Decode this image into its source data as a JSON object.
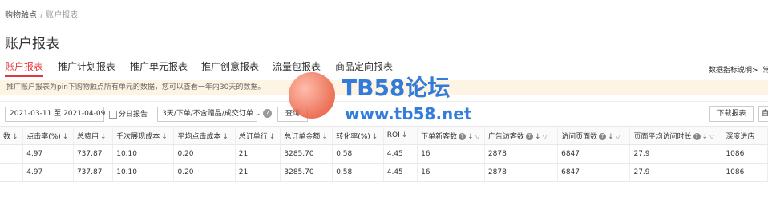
{
  "breadcrumb": {
    "root": "购物触点",
    "separator": "/",
    "current": "账户报表"
  },
  "page_title": "账户报表",
  "tabs": [
    {
      "label": "账户报表",
      "active": true
    },
    {
      "label": "推广计划报表",
      "active": false
    },
    {
      "label": "推广单元报表",
      "active": false
    },
    {
      "label": "推广创意报表",
      "active": false
    },
    {
      "label": "流量包报表",
      "active": false
    },
    {
      "label": "商品定向报表",
      "active": false
    }
  ],
  "help_link": {
    "label": "数据指标说明>",
    "cut_label": "常"
  },
  "notice": "推广账户报表为pin下购物触点所有单元的数据，您可以查看一年内30天的数据。",
  "toolbar": {
    "date_range": "2021-03-11 至 2021-04-09",
    "daily_report_label": "分日报告",
    "attribution_select": "3天/下单/不含赠品/成交订单",
    "help_icon": "?",
    "query_label": "查询",
    "download_label": "下载报表",
    "cut_button_label": "自"
  },
  "table": {
    "columns": [
      {
        "label": "数",
        "sort": true
      },
      {
        "label": "点击率(%)",
        "sort": true
      },
      {
        "label": "总费用",
        "sort": true
      },
      {
        "label": "千次展现成本",
        "sort": true
      },
      {
        "label": "平均点击成本",
        "sort": true
      },
      {
        "label": "总订单行",
        "sort": true
      },
      {
        "label": "总订单金额",
        "sort": true
      },
      {
        "label": "转化率(%)",
        "sort": true
      },
      {
        "label": "ROI",
        "sort": true
      },
      {
        "label": "下单新客数",
        "sort": true,
        "help": true,
        "filter": true
      },
      {
        "label": "广告访客数",
        "sort": true,
        "help": true,
        "filter": true
      },
      {
        "label": "访问页面数",
        "sort": true,
        "help": true,
        "filter": true
      },
      {
        "label": "页面平均访问时长",
        "sort": true,
        "help": true,
        "filter": true
      },
      {
        "label": "深度进店",
        "sort": false
      }
    ],
    "rows": [
      [
        "",
        "4.97",
        "737.87",
        "10.10",
        "0.20",
        "21",
        "3285.70",
        "0.58",
        "4.45",
        "16",
        "2878",
        "6847",
        "27.9",
        "1086"
      ],
      [
        "",
        "4.97",
        "737.87",
        "10.10",
        "0.20",
        "21",
        "3285.70",
        "0.58",
        "4.45",
        "16",
        "2878",
        "6847",
        "27.9",
        "1086"
      ]
    ]
  },
  "watermark": {
    "title": "TB58论坛",
    "url": "www.tb58.net",
    "icon": "hand-logo-icon"
  },
  "colors": {
    "accent": "#e4393c",
    "notice_bg": "#fdf4e3",
    "watermark_blue": "#1e6fd9"
  }
}
